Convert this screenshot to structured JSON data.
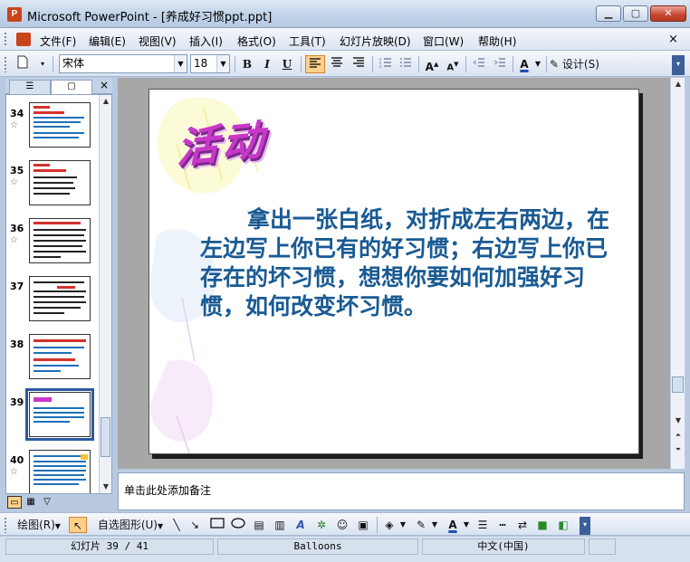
{
  "window": {
    "app_icon_label": "P",
    "title": "Microsoft PowerPoint - [养成好习惯ppt.ppt]",
    "minimize": "▁",
    "maximize": "▢",
    "close": "✕"
  },
  "menu": {
    "items": [
      "文件(F)",
      "编辑(E)",
      "视图(V)",
      "插入(I)",
      "格式(O)",
      "工具(T)",
      "幻灯片放映(D)",
      "窗口(W)",
      "帮助(H)"
    ],
    "close_doc": "×"
  },
  "toolbar": {
    "font_name": "宋体",
    "font_size": "18",
    "bold": "B",
    "italic": "I",
    "underline": "U",
    "design_label": "设计(S)"
  },
  "slides_pane": {
    "tab_outline_icon": "☰",
    "tab_slides_icon": "▢",
    "close": "×",
    "thumbnails": [
      {
        "number": "34",
        "star": "☆"
      },
      {
        "number": "35",
        "star": "☆"
      },
      {
        "number": "36",
        "star": "☆"
      },
      {
        "number": "37",
        "star": ""
      },
      {
        "number": "38",
        "star": ""
      },
      {
        "number": "39",
        "star": "",
        "selected": true
      },
      {
        "number": "40",
        "star": "☆"
      }
    ]
  },
  "slide": {
    "title": "活动",
    "body": "拿出一张白纸，对折成左右两边，在左边写上你已有的好习惯；右边写上你已存在的坏习惯，想想你要如何加强好习惯，如何改变坏习惯。"
  },
  "notes": {
    "placeholder": "单击此处添加备注"
  },
  "drawing_toolbar": {
    "draw_label": "绘图(R)",
    "autoshapes_label": "自选图形(U)"
  },
  "status": {
    "slide_position": "幻灯片 39 / 41",
    "design_template": "Balloons",
    "language": "中文(中国)"
  },
  "colors": {
    "title_magenta": "#c838c8",
    "body_blue": "#1a5a93",
    "accent_orange": "#ffd08a"
  }
}
